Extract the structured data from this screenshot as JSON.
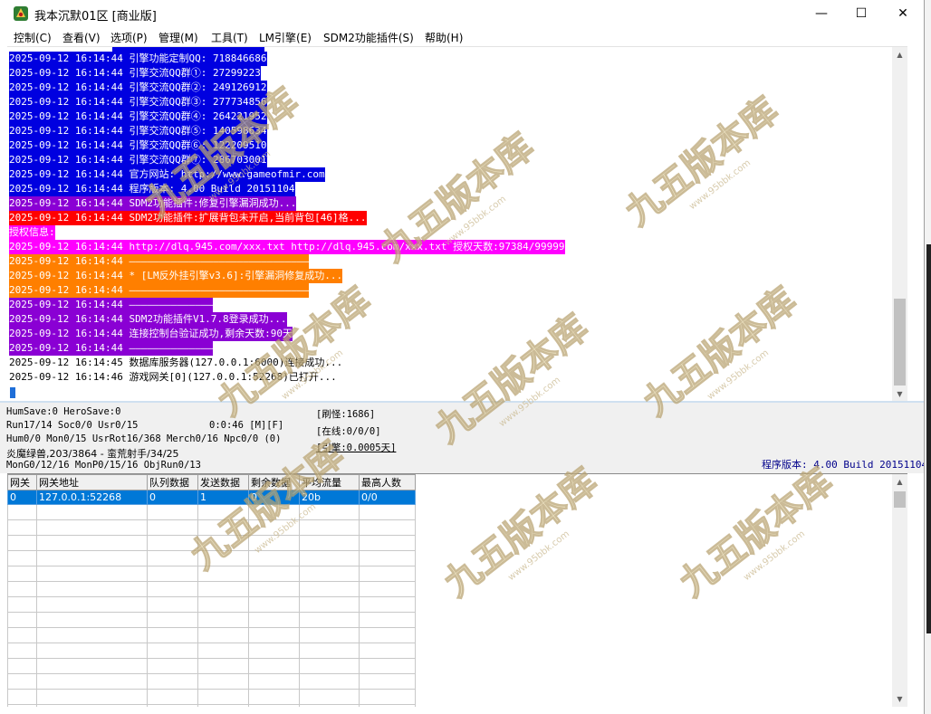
{
  "window": {
    "title": "我本沉默01区 [商业版]",
    "minimize": "—",
    "maximize": "☐",
    "close": "✕"
  },
  "menu": [
    "控制(C)",
    "查看(V)",
    "选项(P)",
    "管理(M)",
    "工具(T)",
    "LM引擎(E)",
    "SDM2功能插件(S)",
    "帮助(H)"
  ],
  "log": [
    {
      "text": "2025-09-12 16:14:44 引擎功能定制QQ: 718846686",
      "bg": "#0000e0"
    },
    {
      "text": "2025-09-12 16:14:44 引擎交流QQ群①: 27299223",
      "bg": "#0000e0"
    },
    {
      "text": "2025-09-12 16:14:44 引擎交流QQ群②: 249126912",
      "bg": "#0000e0"
    },
    {
      "text": "2025-09-12 16:14:44 引擎交流QQ群③: 277734856",
      "bg": "#0000e0"
    },
    {
      "text": "2025-09-12 16:14:44 引擎交流QQ群④: 264221952",
      "bg": "#0000e0"
    },
    {
      "text": "2025-09-12 16:14:44 引擎交流QQ群⑤: 140598634",
      "bg": "#0000e0"
    },
    {
      "text": "2025-09-12 16:14:44 引擎交流QQ群⑥: 122209510",
      "bg": "#0000e0"
    },
    {
      "text": "2025-09-12 16:14:44 引擎交流QQ群⑦: 286703001",
      "bg": "#0000e0"
    },
    {
      "text": "2025-09-12 16:14:44 官方网站: http://www.gameofmir.com",
      "bg": "#0000e0"
    },
    {
      "text": "2025-09-12 16:14:44 程序版本: 4.00 Build 20151104",
      "bg": "#0000e0"
    },
    {
      "text": "2025-09-12 16:14:44 SDM2功能插件:修复引擎漏洞成功...",
      "bg": "#8a00d4"
    },
    {
      "text": "2025-09-12 16:14:44 SDM2功能插件:扩展背包未开启,当前背包[46]格...",
      "bg": "#ff0000"
    },
    {
      "text": "授权信息:",
      "bg": "#ff00ff"
    },
    {
      "text": "2025-09-12 16:14:44 http://dlq.945.com/xxx.txt http://dlq.945.com/xxx.txt 授权天数:97384/99999",
      "bg": "#ff00ff"
    },
    {
      "text": "2025-09-12 16:14:44 ——————————————————————————————",
      "bg": "#ff7f00"
    },
    {
      "text": "2025-09-12 16:14:44 * [LM反外挂引擎v3.6]:引擎漏洞修复成功...",
      "bg": "#ff7f00"
    },
    {
      "text": "2025-09-12 16:14:44 ——————————————————————————————",
      "bg": "#ff7f00"
    },
    {
      "text": "2025-09-12 16:14:44 ——————————————",
      "bg": "#8a00d4"
    },
    {
      "text": "2025-09-12 16:14:44 SDM2功能插件V1.7.8登录成功...",
      "bg": "#8a00d4"
    },
    {
      "text": "2025-09-12 16:14:44 连接控制台验证成功,剩余天数:90天",
      "bg": "#8a00d4"
    },
    {
      "text": "2025-09-12 16:14:44 ——————————————",
      "bg": "#8a00d4"
    },
    {
      "text": "2025-09-12 16:14:45 数据库服务器(127.0.0.1:6000)连接成功...",
      "bg": ""
    },
    {
      "text": "2025-09-12 16:14:46 游戏网关[0](127.0.0.1:52268)已打开...",
      "bg": ""
    }
  ],
  "status": {
    "line1": "HumSave:0 HeroSave:0",
    "line2": "Run17/14 Soc0/0 Usr0/15",
    "timer": "0:0:46 [M][F]",
    "line3": "Hum0/0 Mon0/15 UsrRot16/368 Merch0/16 Npc0/0 (0)",
    "line4": "炎魔绿兽,203/3864 - 蛮荒射手/34/25",
    "line5": "MonG0/12/16 MonP0/15/16 ObjRun0/13",
    "refresh": "[刷怪:1686]",
    "online": "[在线:0/0/0]",
    "engine": "[引擎:0.0005天]",
    "version": "程序版本: 4.00 Build 20151104"
  },
  "gateway_table": {
    "columns": [
      "网关",
      "网关地址",
      "队列数据",
      "发送数据",
      "剩余数据",
      "平均流量",
      "最高人数"
    ],
    "rows": [
      [
        "0",
        "127.0.0.1:52268",
        "0",
        "1",
        "0",
        "20b",
        "0/0"
      ]
    ]
  },
  "watermark": {
    "text": "九五版本库",
    "url": "www.95bbk.com"
  }
}
